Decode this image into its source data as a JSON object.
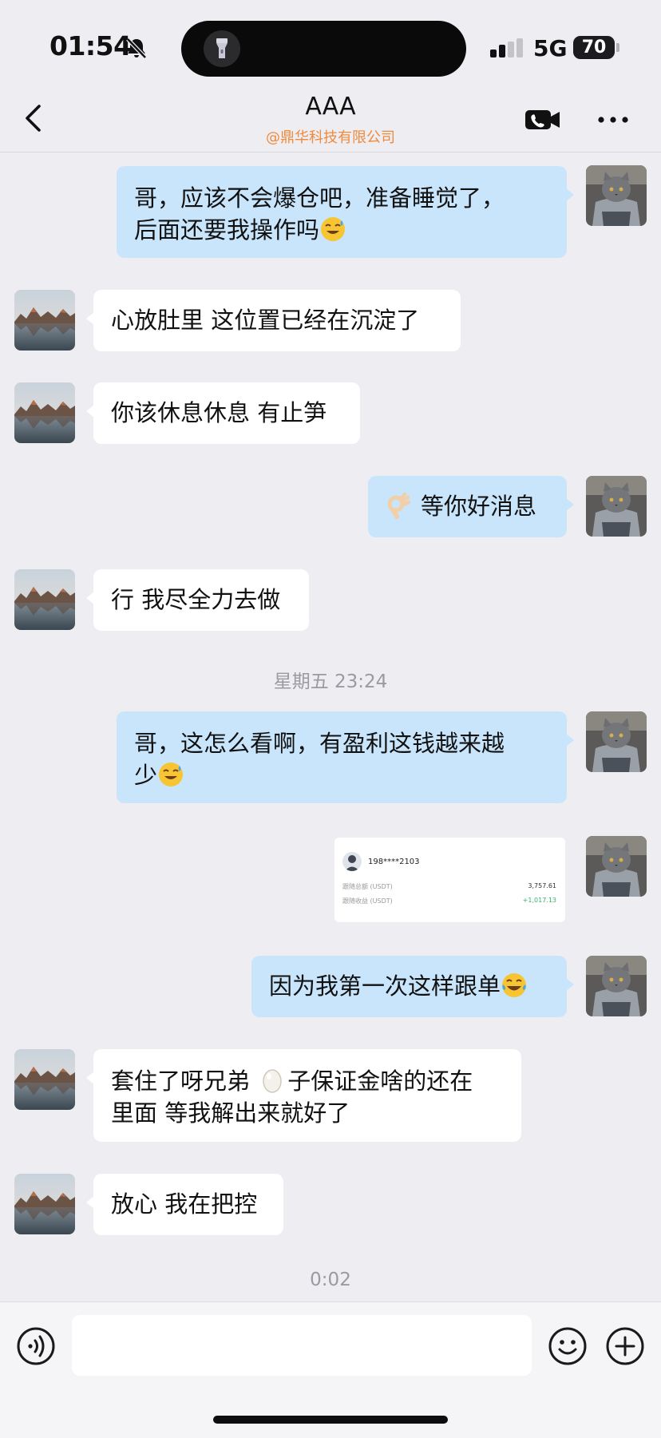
{
  "status_bar": {
    "time": "01:54",
    "network": "5G",
    "battery": "70"
  },
  "header": {
    "title": "AAA",
    "subtitle": "@鼎华科技有限公司"
  },
  "messages": [
    {
      "from": "me",
      "text": "哥，应该不会爆仓吧，准备睡觉了，\n后面还要我操作吗",
      "emoji": "grinning-sweat-emoji"
    },
    {
      "from": "them",
      "text": "心放肚里 这位置已经在沉淀了"
    },
    {
      "from": "them",
      "text": "你该休息休息 有止笋"
    },
    {
      "from": "me",
      "emoji_prefix": "ok-hand-emoji",
      "text": "等你好消息"
    },
    {
      "from": "them",
      "text": "行 我尽全力去做"
    },
    {
      "from": "me",
      "text": "哥，这怎么看啊，有盈利这钱越来越\n少",
      "emoji": "grinning-sweat-emoji"
    },
    {
      "from": "me",
      "type": "image"
    },
    {
      "from": "me",
      "text": "因为我第一次这样跟单",
      "emoji": "tears-of-joy-emoji"
    },
    {
      "from": "them",
      "text_a": "套住了呀兄弟 ",
      "inline_emoji": "egg-emoji",
      "text_b": "子保证金啥的还在\n里面 等我解出来就好了"
    },
    {
      "from": "them",
      "text": "放心 我在把控"
    }
  ],
  "timestamps": {
    "friday": "星期五 23:24",
    "call": "0:02"
  },
  "screenshot_card": {
    "user": "198****2103",
    "rows": [
      {
        "label": "跟随总额 (USDT)",
        "value": "3,757.61"
      },
      {
        "label": "跟随收益 (USDT)",
        "value": "+1,017.13"
      }
    ]
  },
  "input_bar": {
    "placeholder": ""
  },
  "colors": {
    "my_bubble": "#c9e5fb",
    "their_bubble": "#ffffff",
    "accent_orange": "#f08a3c",
    "background": "#ededf2"
  }
}
